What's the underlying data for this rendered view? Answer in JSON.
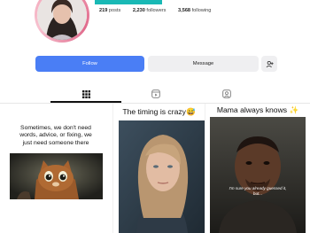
{
  "profile": {
    "stats": {
      "posts_count": "219",
      "posts_label": "posts",
      "followers_count": "2,230",
      "followers_label": "followers",
      "following_count": "3,568",
      "following_label": "following"
    }
  },
  "actions": {
    "follow_label": "Follow",
    "message_label": "Message",
    "add_icon": "add-person-icon"
  },
  "tabs": [
    {
      "icon": "grid-icon",
      "active": true
    },
    {
      "icon": "reels-icon",
      "active": false
    },
    {
      "icon": "tagged-icon",
      "active": false
    }
  ],
  "posts": [
    {
      "caption_line1": "Sometimes, we don't need",
      "caption_line2": "words, advice, or fixing, we",
      "caption_line3": "just need someone there"
    },
    {
      "caption": "The timing is crazy😅"
    },
    {
      "caption": "Mama always knows ✨",
      "subtitle_line1": "I'm sure you already guessed it,",
      "subtitle_line2": "but..."
    }
  ],
  "colors": {
    "accent": "#4a7ef5",
    "teal": "#19b9b5",
    "secondary_button": "#efeff1"
  }
}
